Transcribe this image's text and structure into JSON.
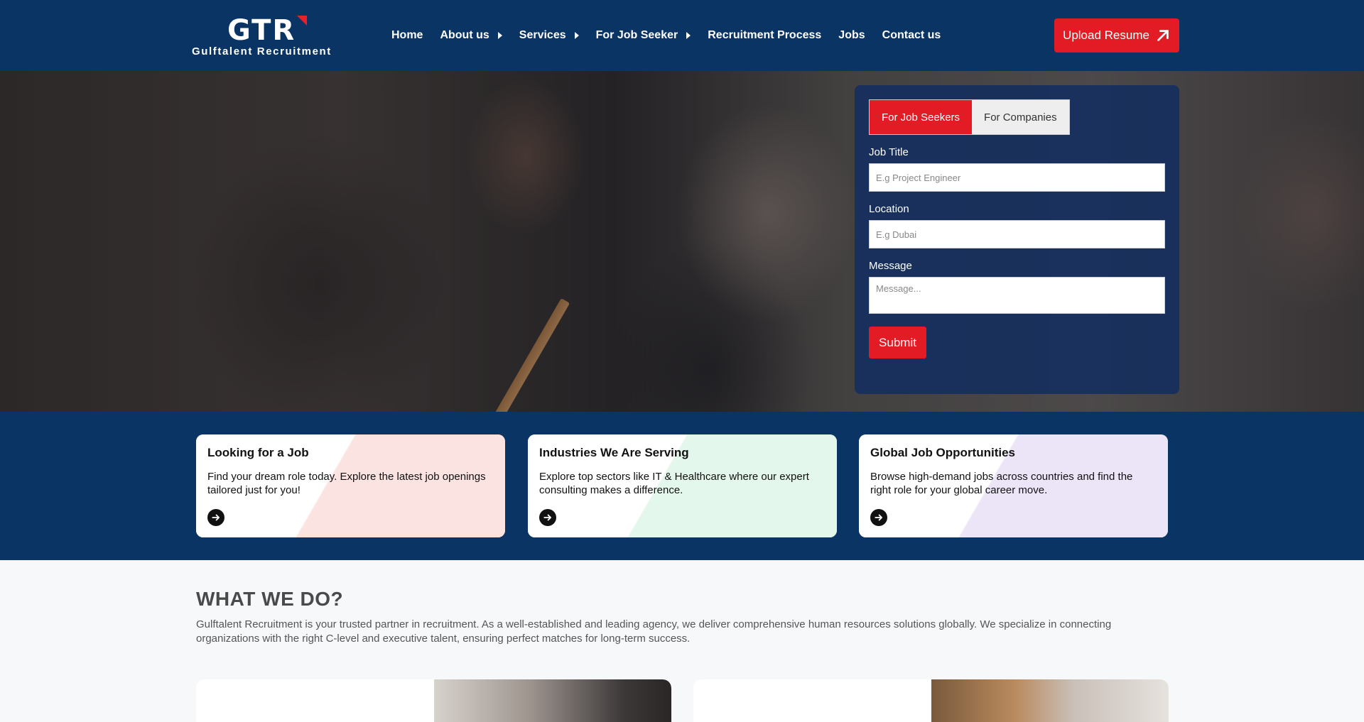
{
  "brand": {
    "mark": "GTR",
    "name": "Gulftalent Recruitment"
  },
  "nav": {
    "items": [
      {
        "label": "Home",
        "has_submenu": false
      },
      {
        "label": "About us",
        "has_submenu": true
      },
      {
        "label": "Services",
        "has_submenu": true
      },
      {
        "label": "For Job Seeker",
        "has_submenu": true
      },
      {
        "label": "Recruitment Process",
        "has_submenu": false
      },
      {
        "label": "Jobs",
        "has_submenu": false
      },
      {
        "label": "Contact us",
        "has_submenu": false
      }
    ],
    "cta_label": "Upload Resume",
    "cta_icon": "arrow-up-right-icon"
  },
  "form": {
    "tabs": [
      {
        "label": "For Job Seekers",
        "active": true
      },
      {
        "label": "For Companies",
        "active": false
      }
    ],
    "job_title_label": "Job Title",
    "job_title_placeholder": "E.g Project Engineer",
    "location_label": "Location",
    "location_placeholder": "E.g Dubai",
    "message_label": "Message",
    "message_placeholder": "Message...",
    "submit_label": "Submit"
  },
  "cards": [
    {
      "title": "Looking for a Job",
      "description": "Find your dream role today. Explore the latest job openings tailored just for you!",
      "tint": "#fbe3e2",
      "icon": "arrow-right-circle-icon"
    },
    {
      "title": "Industries We Are Serving",
      "description": "Explore top sectors like IT & Healthcare where our expert consulting makes a difference.",
      "tint": "#e3f7ec",
      "icon": "arrow-right-circle-icon"
    },
    {
      "title": "Global Job Opportunities",
      "description": "Browse high-demand jobs across countries and find the right role for your global career move.",
      "tint": "#ece4f7",
      "icon": "arrow-right-circle-icon"
    }
  ],
  "what_we_do": {
    "title": "WHAT WE DO?",
    "text": "Gulftalent Recruitment is your trusted partner in recruitment. As a well-established and leading agency, we deliver comprehensive human resources solutions globally. We specialize in connecting organizations with the right C-level and executive talent, ensuring perfect matches for long-term success."
  },
  "colors": {
    "navy": "#0a3463",
    "accent_red": "#e31b24",
    "page_bg": "#f6f8fa"
  }
}
